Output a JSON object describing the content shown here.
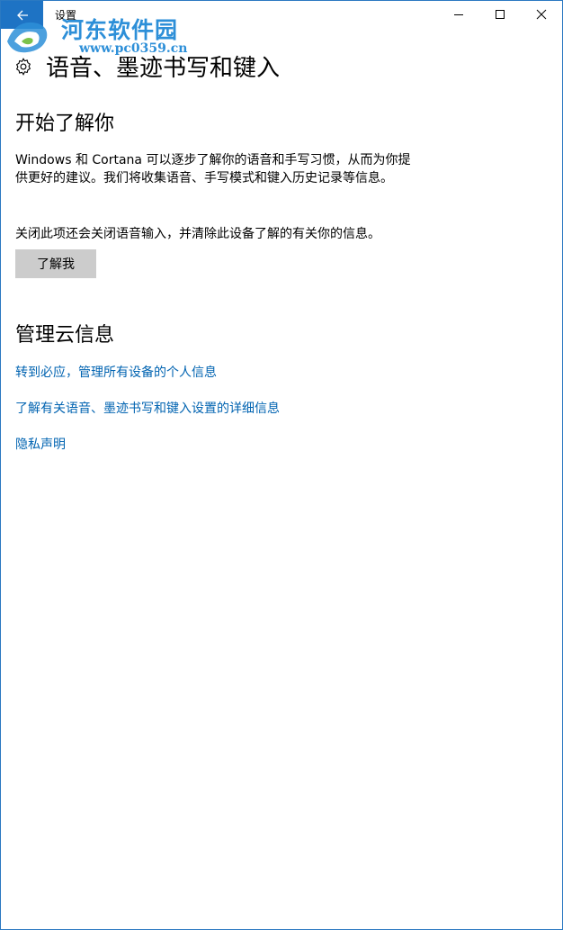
{
  "window": {
    "title": "设置"
  },
  "watermark": {
    "site_name": "河东软件园",
    "url": "www.pc0359.cn"
  },
  "page": {
    "title": "语音、墨迹书写和键入"
  },
  "getting_to_know": {
    "heading": "开始了解你",
    "description": "Windows 和 Cortana 可以逐步了解你的语音和手写习惯，从而为你提供更好的建议。我们将收集语音、手写模式和键入历史记录等信息。",
    "off_note": "关闭此项还会关闭语音输入，并清除此设备了解的有关你的信息。",
    "button_label": "了解我"
  },
  "cloud_info": {
    "heading": "管理云信息",
    "links": [
      "转到必应，管理所有设备的个人信息",
      "了解有关语音、墨迹书写和键入设置的详细信息",
      "隐私声明"
    ]
  },
  "icons": {
    "back": "back-arrow-icon",
    "minimize": "minimize-icon",
    "maximize": "maximize-icon",
    "close": "close-icon",
    "settings": "gear-icon"
  },
  "colors": {
    "accent": "#1e73c4",
    "link": "#0063b1",
    "button_bg": "#cccccc",
    "watermark": "#2d8fd8"
  }
}
